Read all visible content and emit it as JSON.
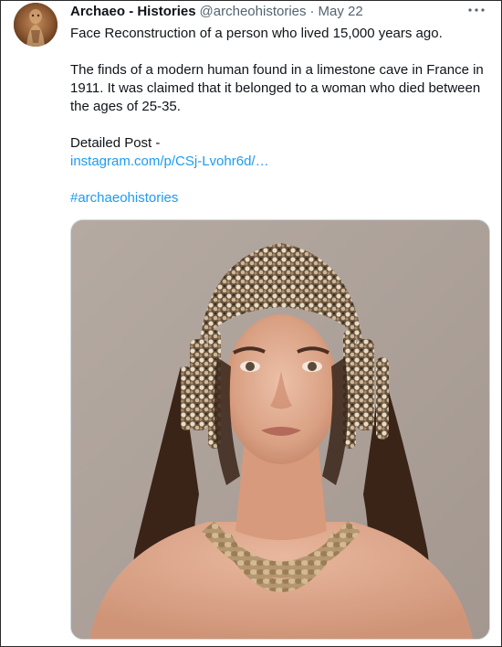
{
  "tweet": {
    "author": {
      "display_name": "Archaeo - Histories",
      "handle": "@archeohistories",
      "separator": "·",
      "date": "May 22",
      "avatar_icon": "bronze-figurine-avatar"
    },
    "more_icon": "more-horizontal-icon",
    "text": {
      "line1": "Face Reconstruction of a person who lived 15,000 years ago.",
      "paragraph2": "The finds of a modern human found in a limestone cave in France in 1911. It was claimed that it belonged to a woman who died between the ages of 25-35.",
      "detailed_label": "Detailed Post -",
      "link": "instagram.com/p/CSj-Lvohr6d/…",
      "hashtag": "#archaeohistories"
    },
    "media": {
      "description_icon": "face-reconstruction-photo"
    }
  },
  "colors": {
    "text": "#0f1419",
    "secondary": "#536471",
    "link": "#1d9bf0",
    "media_border": "#cfd9de"
  }
}
